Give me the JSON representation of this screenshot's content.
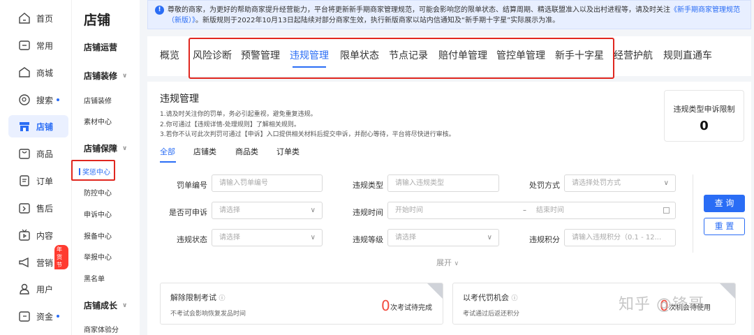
{
  "nav": {
    "items": [
      {
        "label": "首页",
        "icon": "home-icon"
      },
      {
        "label": "常用",
        "icon": "folder-icon"
      },
      {
        "label": "商城",
        "icon": "mall-icon"
      },
      {
        "label": "搜索",
        "icon": "search-icon"
      },
      {
        "label": "店铺",
        "icon": "store-icon"
      },
      {
        "label": "商品",
        "icon": "goods-icon"
      },
      {
        "label": "订单",
        "icon": "order-icon"
      },
      {
        "label": "售后",
        "icon": "aftersale-icon"
      },
      {
        "label": "内容",
        "icon": "content-icon"
      },
      {
        "label": "营销",
        "icon": "marketing-icon",
        "badge": "年货节"
      },
      {
        "label": "用户",
        "icon": "user-icon"
      },
      {
        "label": "资金",
        "icon": "wallet-icon"
      }
    ],
    "active": "店铺"
  },
  "subnav": {
    "title": "店铺",
    "groups": [
      "店铺运营",
      "店铺装修",
      "店铺保障",
      "店铺成长"
    ],
    "items": [
      "店铺装修",
      "素材中心",
      "奖惩中心",
      "防控中心",
      "申诉中心",
      "报备中心",
      "举报中心",
      "黑名单",
      "商家体验分"
    ],
    "active": "奖惩中心"
  },
  "notice": {
    "icon": "info-icon",
    "text1": "尊敬的商家，为更好的帮助商家提升经营能力，平台将更新新手期商家管理规范，可能会影响您的限单状态、结算周期、精选联盟准入以及出村进程等，请及时关注",
    "link": "《新手期商家管理规范（新版）》",
    "text2": "。新版规则于2022年10月13日起陆续对部分商家生效，执行新版商家以站内信通知及“新手期十字星”实际展示为准。"
  },
  "tabs": [
    "概览",
    "风险诊断",
    "预警管理",
    "违规管理",
    "限单状态",
    "节点记录",
    "赔付单管理",
    "管控单管理",
    "新手十字星",
    "经营护航",
    "规则直通车"
  ],
  "active_tab": "违规管理",
  "panel": {
    "title": "违规管理",
    "tips": [
      "1.请及时关注你的罚单，务必引起重视，避免重复违规。",
      "2.你可通过【违规详情-处理规则】了解相关规则。",
      "3.若你不认可此次判罚可通过【申诉】入口提供相关材料后提交申诉，并耐心等待，平台将尽快进行审核。"
    ],
    "limit_label": "违规类型申诉限制",
    "limit_value": "0",
    "filter_tabs": [
      "全部",
      "店铺类",
      "商品类",
      "订单类"
    ],
    "fields": {
      "penalty_no": {
        "label": "罚单编号",
        "placeholder": "请输入罚单编号"
      },
      "violation_type": {
        "label": "违规类型",
        "placeholder": "请输入违规类型"
      },
      "penalty_method": {
        "label": "处罚方式",
        "placeholder": "请选择处罚方式"
      },
      "appealable": {
        "label": "是否可申诉",
        "placeholder": "请选择"
      },
      "violation_time": {
        "label": "违规时间",
        "start": "开始时间",
        "sep": "–",
        "end": "结束时间"
      },
      "violation_status": {
        "label": "违规状态",
        "placeholder": "请选择"
      },
      "violation_level": {
        "label": "违规等级",
        "placeholder": "请选择"
      },
      "violation_points": {
        "label": "违规积分",
        "placeholder": "请输入违规积分（0.1 - 12..."
      }
    },
    "query_label": "查 询",
    "reset_label": "重 置",
    "expand_label": "展开",
    "cards": [
      {
        "title": "解除限制考试",
        "sub": "不考试会影响恢复发品时间",
        "count": "0",
        "unit": "次考试待完成"
      },
      {
        "title": "以考代罚机会",
        "sub": "考试通过后返还积分",
        "count": "0",
        "unit": "次机会待使用"
      }
    ]
  },
  "watermark": "知乎 @锋哥"
}
